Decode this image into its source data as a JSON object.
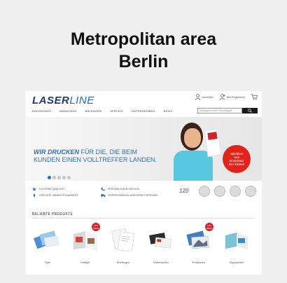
{
  "caption": {
    "line1": "Metropolitan area",
    "line2": "Berlin"
  },
  "site": {
    "logo_part1": "LASER",
    "logo_part2": "LINE",
    "header_icons": [
      {
        "icon": "user-icon",
        "label": "Anmelden"
      },
      {
        "icon": "register-icon",
        "label": "Neu Registrieren"
      },
      {
        "icon": "cart-icon",
        "label": ""
      }
    ],
    "nav": [
      "DRUCKSHOP",
      "BRANCHEN",
      "ANFRAGEN",
      "SERVICE",
      "UNTERNEHMEN",
      "NEWS"
    ],
    "search_placeholder": "Auftragsnummer / Suchbegriff"
  },
  "hero": {
    "line1_bold": "WIR DRUCKEN",
    "line1_rest": " FÜR DIE, DIE BEIM",
    "line2": "KUNDEN EINEN VOLLTREFFER LANDEN.",
    "badge": "Spielplan\nzum\nDownload\nhier klicken",
    "slides": 5,
    "active_slide": 1,
    "accent": "#2f6db5"
  },
  "features": [
    {
      "icon": "star-icon",
      "text": "5 STERNE QUALITÄT"
    },
    {
      "icon": "leaf-icon",
      "text": "HÖCHSTE UMWELTSTANDARDS"
    },
    {
      "icon": "phone-icon",
      "text": "PERSÖNLICHER SERVICE"
    },
    {
      "icon": "truck-icon",
      "text": "EXPRESSDRUCK UND DIREKTVERSAND"
    }
  ],
  "seal_text": "120",
  "products": {
    "title": "BELIEBTE PRODUKTE",
    "items": [
      {
        "label": "Flyer",
        "hot": ""
      },
      {
        "label": "Faltflyer",
        "hot": "10% Rabatt"
      },
      {
        "label": "Briefbogen",
        "hot": ""
      },
      {
        "label": "Visitenkarten",
        "hot": ""
      },
      {
        "label": "Postkarten",
        "hot": "10% Rabatt"
      },
      {
        "label": "Klappkarten",
        "hot": ""
      }
    ]
  }
}
